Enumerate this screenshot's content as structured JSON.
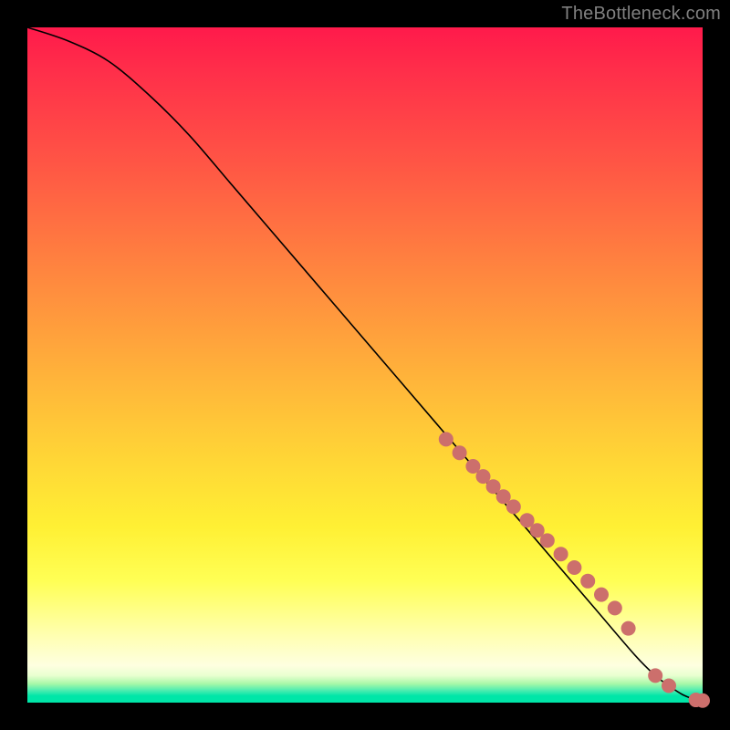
{
  "attribution": "TheBottleneck.com",
  "chart_data": {
    "type": "line",
    "title": "",
    "xlabel": "",
    "ylabel": "",
    "xlim": [
      0,
      100
    ],
    "ylim": [
      0,
      100
    ],
    "series": [
      {
        "name": "bottleneck-curve",
        "x": [
          0,
          6,
          12,
          18,
          24,
          30,
          36,
          42,
          48,
          54,
          60,
          66,
          72,
          78,
          84,
          90,
          93,
          95,
          97,
          99,
          100
        ],
        "y": [
          100,
          98,
          95,
          90,
          84,
          77,
          70,
          63,
          56,
          49,
          42,
          35,
          28,
          21,
          14,
          7,
          4,
          2.5,
          1.2,
          0.4,
          0.2
        ]
      }
    ],
    "markers": {
      "name": "highlighted-points",
      "color": "#cc6f6c",
      "x": [
        62,
        64,
        66,
        67.5,
        69,
        70.5,
        72,
        74,
        75.5,
        77,
        79,
        81,
        83,
        85,
        87,
        89,
        93,
        95,
        99,
        100
      ],
      "y": [
        39,
        37,
        35,
        33.5,
        32,
        30.5,
        29,
        27,
        25.5,
        24,
        22,
        20,
        18,
        16,
        14,
        11,
        4,
        2.5,
        0.4,
        0.3
      ]
    },
    "background_gradient": {
      "top": "#ff1a4b",
      "mid_upper": "#ff853f",
      "mid": "#ffd636",
      "mid_lower": "#ffffb0",
      "bottom": "#00e6a8"
    }
  }
}
